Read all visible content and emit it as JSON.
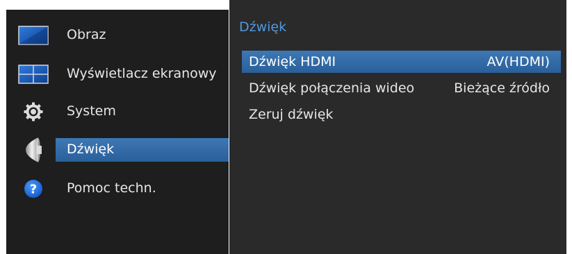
{
  "colors": {
    "menu_background": "#1e1e1e",
    "panel_background": "#2a2a2a",
    "highlight": "#3368a6",
    "title_accent": "#4f97e0",
    "text": "#e6e6e6"
  },
  "sidebar": {
    "items": [
      {
        "label": "Obraz",
        "icon": "picture-icon"
      },
      {
        "label": "Wyświetlacz ekranowy",
        "icon": "onscreen-display-icon"
      },
      {
        "label": "System",
        "icon": "gear-icon"
      },
      {
        "label": "Dźwięk",
        "icon": "speaker-icon",
        "selected": true
      },
      {
        "label": "Pomoc techn.",
        "icon": "help-icon"
      }
    ]
  },
  "panel": {
    "title": "Dźwięk",
    "rows": [
      {
        "label": "Dźwięk HDMI",
        "value": "AV(HDMI)",
        "selected": true
      },
      {
        "label": "Dźwięk połączenia wideo",
        "value": "Bieżące źródło"
      },
      {
        "label": "Zeruj dźwięk",
        "value": ""
      }
    ]
  }
}
